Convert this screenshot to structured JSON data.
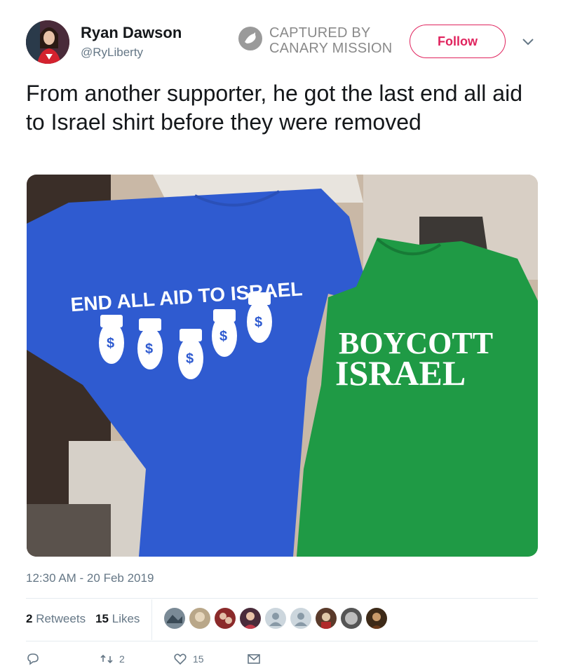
{
  "user": {
    "display_name": "Ryan Dawson",
    "handle": "@RyLiberty"
  },
  "stamp": {
    "line1": "CAPTURED BY",
    "line2": "CANARY MISSION"
  },
  "follow_label": "Follow",
  "tweet": {
    "text": "From another supporter, he got the last end all aid to Israel shirt before they were removed",
    "timestamp": "12:30 AM - 20 Feb 2019"
  },
  "photo": {
    "blue_shirt_text": "END ALL AID TO ISRAEL",
    "green_shirt_line1": "BOYCOTT",
    "green_shirt_line2": "ISRAEL",
    "bag_symbol": "$"
  },
  "stats": {
    "retweets_count": "2",
    "retweets_label": "Retweets",
    "likes_count": "15",
    "likes_label": "Likes"
  },
  "likers": [
    {
      "name": "liker-1",
      "color": "#7a8a96"
    },
    {
      "name": "liker-2",
      "color": "#b9a789"
    },
    {
      "name": "liker-3",
      "color": "#8b2a2a"
    },
    {
      "name": "liker-4",
      "color": "#c23a4a"
    },
    {
      "name": "liker-5",
      "color": "#ccd6dd"
    },
    {
      "name": "liker-6",
      "color": "#ccd6dd"
    },
    {
      "name": "liker-7",
      "color": "#5a3a2a"
    },
    {
      "name": "liker-8",
      "color": "#555555"
    },
    {
      "name": "liker-9",
      "color": "#3d2a18"
    }
  ],
  "actions": {
    "reply_count": "",
    "retweet_count": "2",
    "like_count": "15"
  },
  "colors": {
    "follow_accent": "#e0245e",
    "secondary_text": "#657786",
    "blue_shirt": "#2f5bd0",
    "green_shirt": "#1f9a45"
  }
}
